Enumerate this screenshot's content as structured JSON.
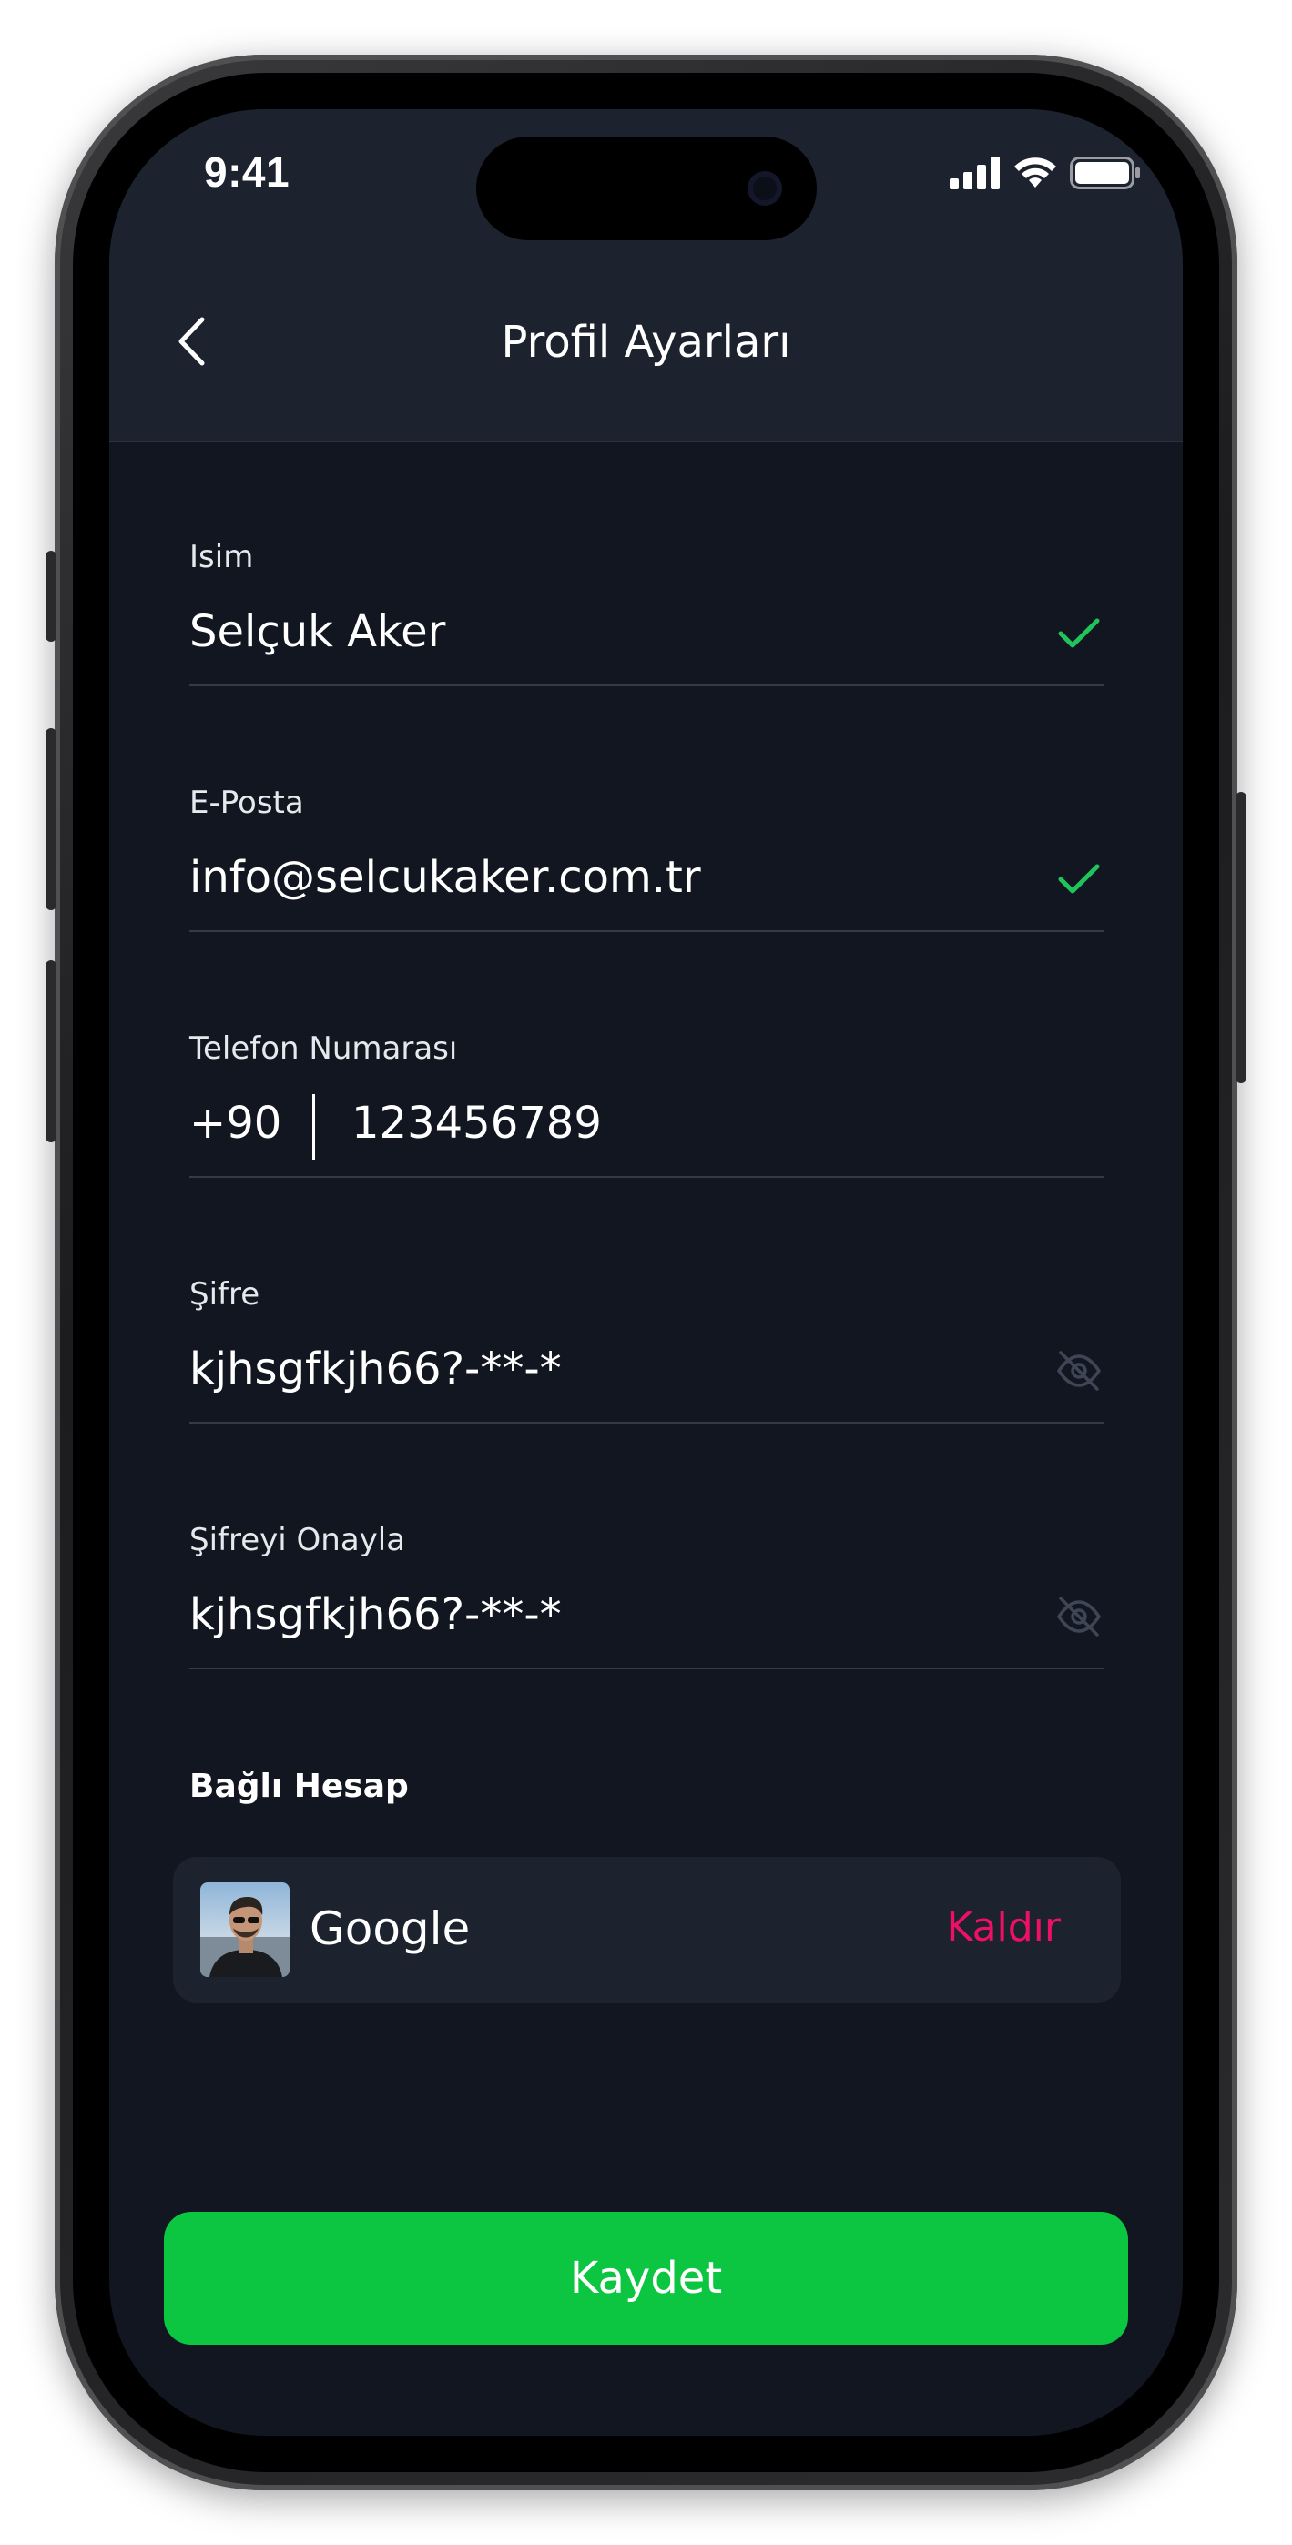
{
  "status_bar": {
    "time": "9:41"
  },
  "header": {
    "title": "Profil Ayarları",
    "back_icon": "chevron-left-icon"
  },
  "form": {
    "name": {
      "label": "Isim",
      "value": "Selçuk Aker",
      "status_icon": "check-icon"
    },
    "email": {
      "label": "E-Posta",
      "value": "info@selcukaker.com.tr",
      "status_icon": "check-icon"
    },
    "phone": {
      "label": "Telefon Numarası",
      "country_code": "+90",
      "number": "123456789"
    },
    "password": {
      "label": "Şifre",
      "value": "kjhsgfkjh66?-**-*",
      "toggle_icon": "eye-off-icon"
    },
    "password_confirm": {
      "label": "Şifreyi Onayla",
      "value": "kjhsgfkjh66?-**-*",
      "toggle_icon": "eye-off-icon"
    }
  },
  "linked_account": {
    "section_title": "Bağlı Hesap",
    "provider": "Google",
    "remove_label": "Kaldır"
  },
  "actions": {
    "save_label": "Kaydet"
  },
  "colors": {
    "background": "#121620",
    "header": "#1c222e",
    "accent_green": "#0cc540",
    "check_green": "#1fc45a",
    "danger_pink": "#ee1064"
  }
}
